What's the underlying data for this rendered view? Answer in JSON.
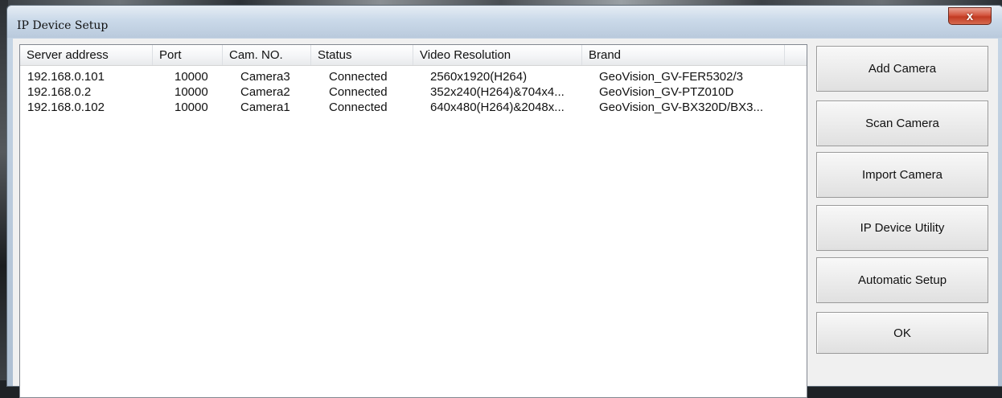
{
  "window": {
    "title": "IP Device Setup",
    "close_glyph": "x"
  },
  "table": {
    "columns": [
      "Server address",
      "Port",
      "Cam. NO.",
      "Status",
      "Video Resolution",
      "Brand"
    ],
    "rows": [
      [
        "192.168.0.101",
        "10000",
        "Camera3",
        "Connected",
        "2560x1920(H264)",
        "GeoVision_GV-FER5302/3"
      ],
      [
        "192.168.0.2",
        "10000",
        "Camera2",
        "Connected",
        "352x240(H264)&704x4...",
        "GeoVision_GV-PTZ010D"
      ],
      [
        "192.168.0.102",
        "10000",
        "Camera1",
        "Connected",
        "640x480(H264)&2048x...",
        "GeoVision_GV-BX320D/BX3..."
      ]
    ]
  },
  "buttons": {
    "add_camera": "Add Camera",
    "scan_camera": "Scan Camera",
    "import_camera": "Import Camera",
    "ip_device_utility": "IP Device Utility",
    "automatic_setup": "Automatic Setup",
    "ok": "OK"
  }
}
